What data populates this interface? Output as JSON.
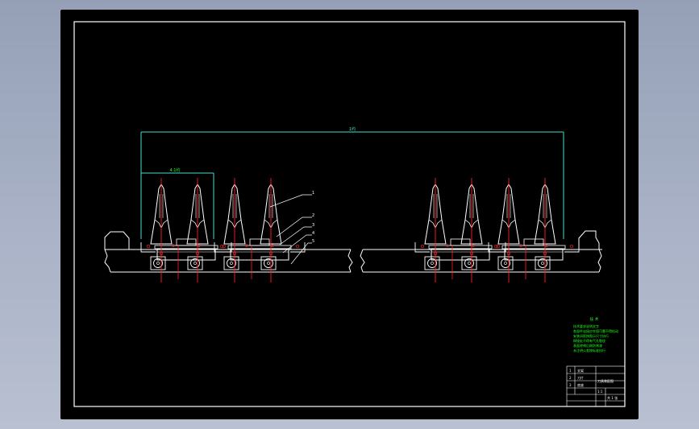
{
  "drawing": {
    "dimensions": {
      "overall": "1约",
      "segment": "4.1约"
    },
    "part_callouts": [
      "1",
      "2",
      "3",
      "4",
      "5"
    ],
    "notes": {
      "title": "技 术",
      "lines": [
        "技术要求说明文字",
        "各部件连接应牢固可靠不得松动",
        "安装间距按图示尺寸执行",
        "焊接处不得有气孔裂纹",
        "表面除锈后刷防锈漆",
        "未注明公差按标准执行"
      ]
    },
    "title_block": {
      "rows": [
        [
          "1",
          "支架"
        ],
        [
          "2",
          "刀片"
        ],
        [
          "3",
          "底座"
        ]
      ],
      "drawing_name": "刀具装配图",
      "scale": "1:1",
      "sheet": "共 1 张"
    },
    "colors": {
      "background": "#000000",
      "lines": "#ffffff",
      "center_lines": "#ff2020",
      "dimensions": "#40e0d0",
      "notes": "#22ff22"
    }
  }
}
